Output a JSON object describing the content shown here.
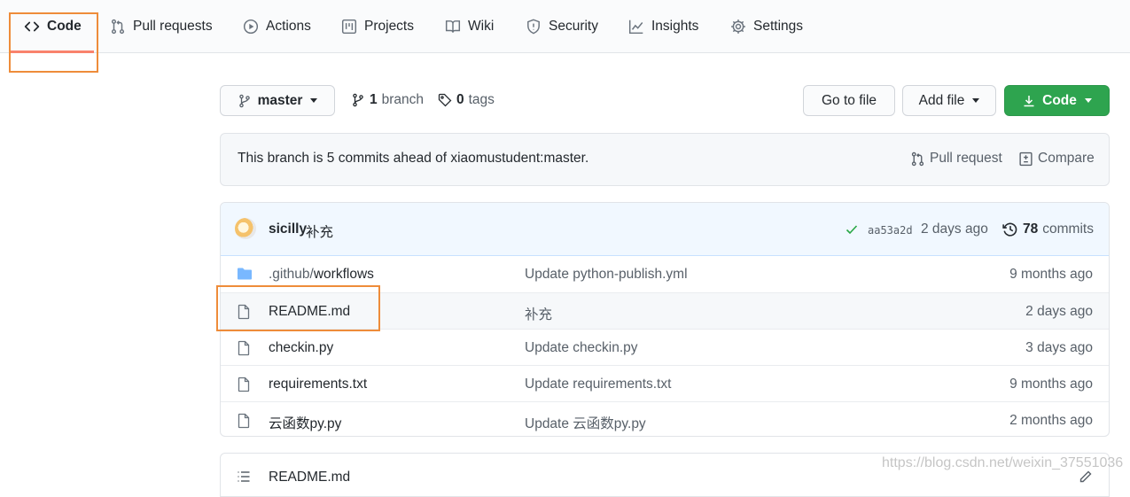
{
  "tabs": [
    {
      "label": "Code",
      "icon": "code-icon",
      "selected": true
    },
    {
      "label": "Pull requests",
      "icon": "pull-request-icon"
    },
    {
      "label": "Actions",
      "icon": "play-icon"
    },
    {
      "label": "Projects",
      "icon": "project-icon"
    },
    {
      "label": "Wiki",
      "icon": "book-icon"
    },
    {
      "label": "Security",
      "icon": "shield-icon"
    },
    {
      "label": "Insights",
      "icon": "graph-icon"
    },
    {
      "label": "Settings",
      "icon": "gear-icon"
    }
  ],
  "repo_bar": {
    "branch_selector": "master",
    "branch_count": "1",
    "branch_label": "branch",
    "tag_count": "0",
    "tag_label": "tags",
    "go_to_file": "Go to file",
    "add_file": "Add file",
    "code_button": "Code"
  },
  "ahead_notice": {
    "text": "This branch is 5 commits ahead of xiaomustudent:master.",
    "pull_request": "Pull request",
    "compare": "Compare"
  },
  "latest_commit": {
    "author": "sicilly",
    "message": "补充",
    "sha": "aa53a2d",
    "time": "2 days ago",
    "commit_count": "78",
    "commits_label": "commits"
  },
  "files": [
    {
      "type": "folder",
      "name_dim": ".github/",
      "name": "workflows",
      "message": "Update python-publish.yml",
      "age": "9 months ago"
    },
    {
      "type": "file",
      "name_dim": "",
      "name": "README.md",
      "message": "补充",
      "age": "2 days ago"
    },
    {
      "type": "file",
      "name_dim": "",
      "name": "checkin.py",
      "message": "Update checkin.py",
      "age": "3 days ago"
    },
    {
      "type": "file",
      "name_dim": "",
      "name": "requirements.txt",
      "message": "Update requirements.txt",
      "age": "9 months ago"
    },
    {
      "type": "file",
      "name_dim": "",
      "name": "云函数py.py",
      "message": "Update 云函数py.py",
      "age": "2 months ago"
    }
  ],
  "readme_header": {
    "title": "README.md"
  },
  "watermark": "https://blog.csdn.net/weixin_37551036",
  "colors": {
    "accent_green": "#2ea44f",
    "tab_underline": "#f9826c",
    "annotation_box": "#ee8c3a",
    "folder": "#79b8ff"
  }
}
